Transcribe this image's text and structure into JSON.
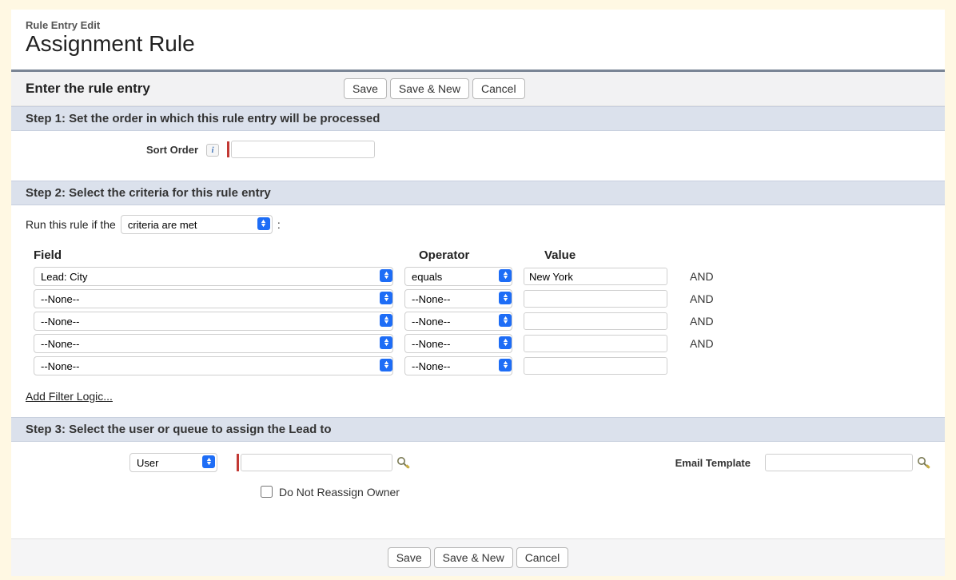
{
  "header": {
    "eyebrow": "Rule Entry Edit",
    "title": "Assignment Rule"
  },
  "buttons": {
    "save": "Save",
    "save_new": "Save & New",
    "cancel": "Cancel"
  },
  "section": {
    "enter_rule_entry": "Enter the rule entry"
  },
  "step1": {
    "heading": "Step 1: Set the order in which this rule entry will be processed",
    "sort_order_label": "Sort Order",
    "sort_order_value": ""
  },
  "step2": {
    "heading": "Step 2: Select the criteria for this rule entry",
    "run_prefix": "Run this rule if the",
    "criteria_mode": "criteria are met",
    "colon": ":",
    "headers": {
      "field": "Field",
      "operator": "Operator",
      "value": "Value"
    },
    "rows": [
      {
        "field": "Lead: City",
        "operator": "equals",
        "value": "New York",
        "logic": "AND"
      },
      {
        "field": "--None--",
        "operator": "--None--",
        "value": "",
        "logic": "AND"
      },
      {
        "field": "--None--",
        "operator": "--None--",
        "value": "",
        "logic": "AND"
      },
      {
        "field": "--None--",
        "operator": "--None--",
        "value": "",
        "logic": "AND"
      },
      {
        "field": "--None--",
        "operator": "--None--",
        "value": "",
        "logic": ""
      }
    ],
    "add_filter_logic": "Add Filter Logic..."
  },
  "step3": {
    "heading": "Step 3: Select the user or queue to assign the Lead to",
    "assignee_type": "User",
    "assignee_value": "",
    "email_template_label": "Email Template",
    "email_template_value": "",
    "dnro_label": "Do Not Reassign Owner",
    "dnro_checked": false
  },
  "icons": {
    "info": "i",
    "lookup": "lookup-icon"
  }
}
